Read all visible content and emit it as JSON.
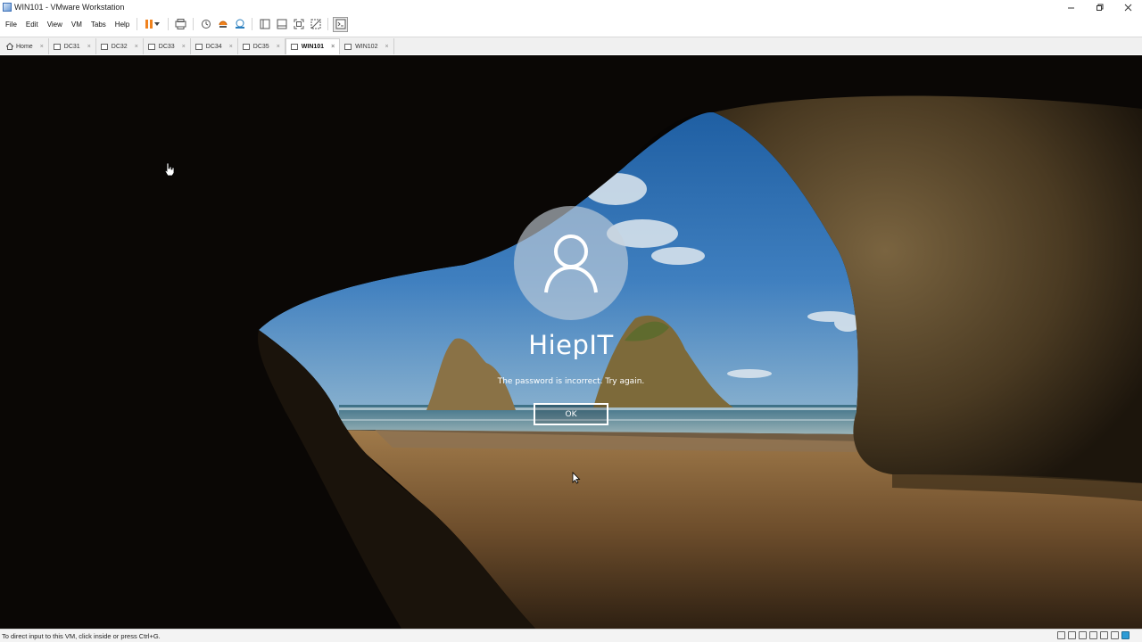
{
  "window": {
    "title": "WIN101 - VMware Workstation",
    "controls": [
      "minimize-icon",
      "restore-icon",
      "close-icon"
    ]
  },
  "menu": {
    "items": [
      "File",
      "Edit",
      "View",
      "VM",
      "Tabs",
      "Help"
    ]
  },
  "toolbar": {
    "icons": [
      "pause-icon",
      "send-ctrl-alt-del-icon",
      "snapshot-icon",
      "revert-snapshot-icon",
      "snapshot-manager-icon",
      "library-icon",
      "thumbnail-bar-icon",
      "full-screen-icon",
      "unity-icon",
      "console-view-icon"
    ]
  },
  "tabs": [
    {
      "label": "Home",
      "icon": "home-icon",
      "active": false
    },
    {
      "label": "DC31",
      "icon": "vm-icon",
      "active": false
    },
    {
      "label": "DC32",
      "icon": "vm-icon",
      "active": false
    },
    {
      "label": "DC33",
      "icon": "vm-icon",
      "active": false
    },
    {
      "label": "DC34",
      "icon": "vm-icon",
      "active": false
    },
    {
      "label": "DC35",
      "icon": "vm-icon",
      "active": false
    },
    {
      "label": "WIN101",
      "icon": "vm-icon",
      "active": true
    },
    {
      "label": "WIN102",
      "icon": "vm-icon",
      "active": false
    }
  ],
  "tab_close": "×",
  "login": {
    "username": "HiepIT",
    "message": "The password is incorrect. Try again.",
    "ok_label": "OK"
  },
  "statusbar": {
    "text": "To direct input to this VM, click inside or press Ctrl+G."
  }
}
